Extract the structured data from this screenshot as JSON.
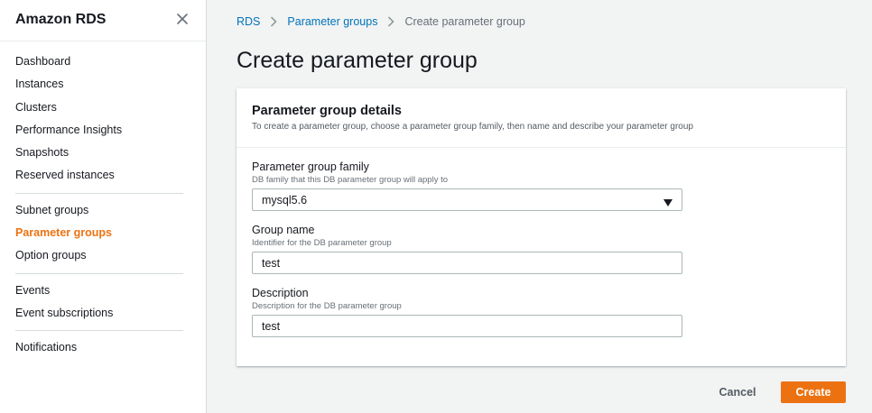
{
  "sidebar": {
    "title": "Amazon RDS",
    "close_icon": "close-icon",
    "groups": [
      [
        "Dashboard",
        "Instances",
        "Clusters",
        "Performance Insights",
        "Snapshots",
        "Reserved instances"
      ],
      [
        "Subnet groups",
        "Parameter groups",
        "Option groups"
      ],
      [
        "Events",
        "Event subscriptions"
      ],
      [
        "Notifications"
      ]
    ],
    "active_item": "Parameter groups",
    "active_color": "#ec7211"
  },
  "breadcrumb": {
    "items": [
      "RDS",
      "Parameter groups"
    ],
    "current": "Create parameter group",
    "separator_icon": "chevron-right-icon"
  },
  "page": {
    "title": "Create parameter group"
  },
  "panel": {
    "title": "Parameter group details",
    "description": "To create a parameter group, choose a parameter group family, then name and describe your parameter group",
    "fields": {
      "family": {
        "label": "Parameter group family",
        "help": "DB family that this DB parameter group will apply to",
        "value": "mysql5.6",
        "icon": "caret-down-icon"
      },
      "name": {
        "label": "Group name",
        "help": "Identifier for the DB parameter group",
        "value": "test"
      },
      "description": {
        "label": "Description",
        "help": "Description for the DB parameter group",
        "value": "test"
      }
    }
  },
  "actions": {
    "cancel_label": "Cancel",
    "create_label": "Create",
    "primary_color": "#ec7211"
  }
}
